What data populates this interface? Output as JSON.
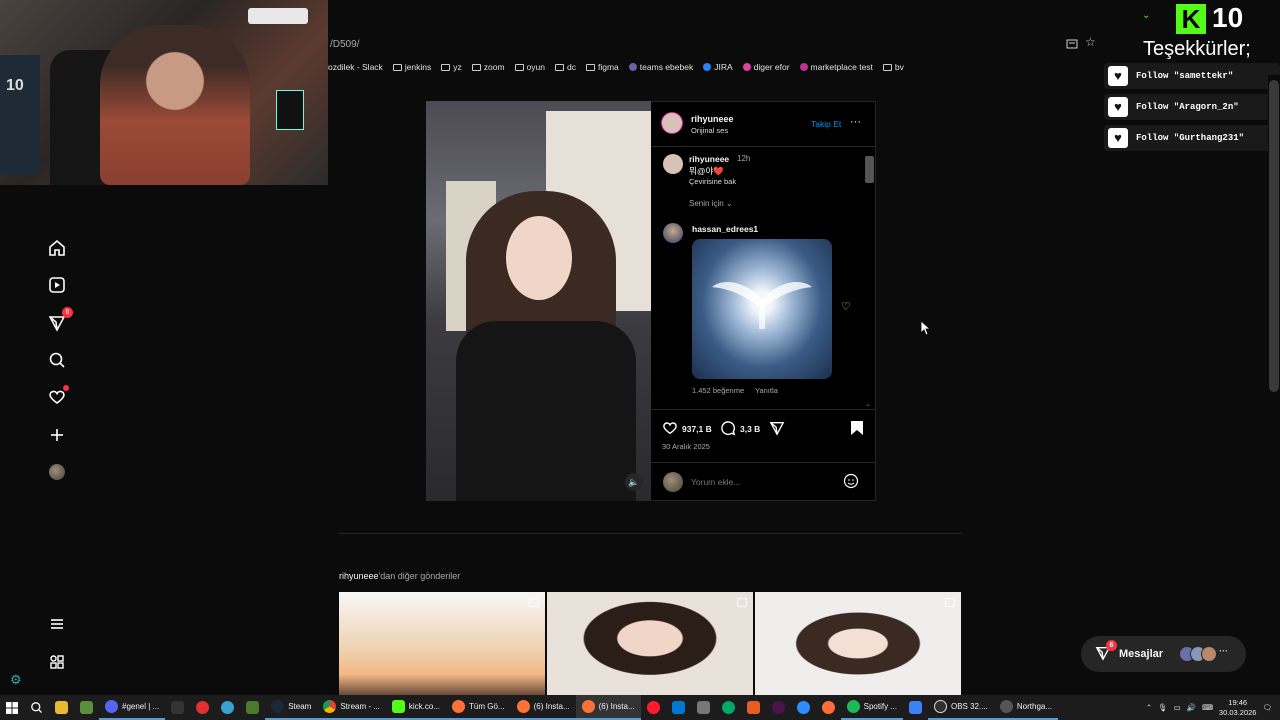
{
  "browser": {
    "url": "/D509/",
    "bookmarks": [
      "ozdilek - Slack",
      "jenkins",
      "yz",
      "zoom",
      "oyun",
      "dc",
      "figma",
      "teams ebebek",
      "JIRA",
      "diger efor",
      "marketplace test",
      "bv"
    ]
  },
  "overlay": {
    "kick_logo": "K",
    "kick_count": "10",
    "thanks": "Teşekkürler;",
    "follows": [
      "Follow \"samettekr\"",
      "Follow \"Aragorn_2n\"",
      "Follow \"Gurthang231\""
    ]
  },
  "webcam": {
    "jersey_number": "10"
  },
  "nav": {
    "notifications_badge": "6",
    "icons": [
      "home-icon",
      "reels-icon",
      "messages-icon",
      "search-icon",
      "notifications-icon",
      "create-icon",
      "profile-icon",
      "menu-icon",
      "more-icon"
    ]
  },
  "post": {
    "author": "rihyuneee",
    "audio": "Orijinal ses",
    "follow_label": "Takip Et",
    "caption_author": "rihyuneee",
    "caption_time": "12h",
    "caption_text": "뭐@야❤️",
    "translate_label": "Çevirisine bak",
    "for_you_label": "Senin için",
    "comment_author": "hassan_edrees1",
    "comment_likes": "1.452 beğenme",
    "reply_label": "Yanıtla",
    "likes": "937,1 B",
    "comments": "3,3 B",
    "date": "30 Aralık 2025",
    "comment_placeholder": "Yorum ekle..."
  },
  "more_posts": {
    "author": "rihyuneee",
    "suffix": "'dan diğer gönderiler"
  },
  "messages": {
    "label": "Mesajlar",
    "badge": "6",
    "more": "···"
  },
  "taskbar": {
    "items": [
      "#genel | ...",
      "Steam",
      "Stream - ...",
      "kick.co...",
      "Tüm Gö...",
      "(6) Insta...",
      "(6) Insta...",
      "Spotify ...",
      "OBS 32....",
      "Northga..."
    ],
    "time": "19:46",
    "date": "30.03.2026"
  },
  "colors": {
    "accent_blue": "#0095f6",
    "kick_green": "#53fc18",
    "badge_red": "#ff3040",
    "background": "#000000"
  }
}
